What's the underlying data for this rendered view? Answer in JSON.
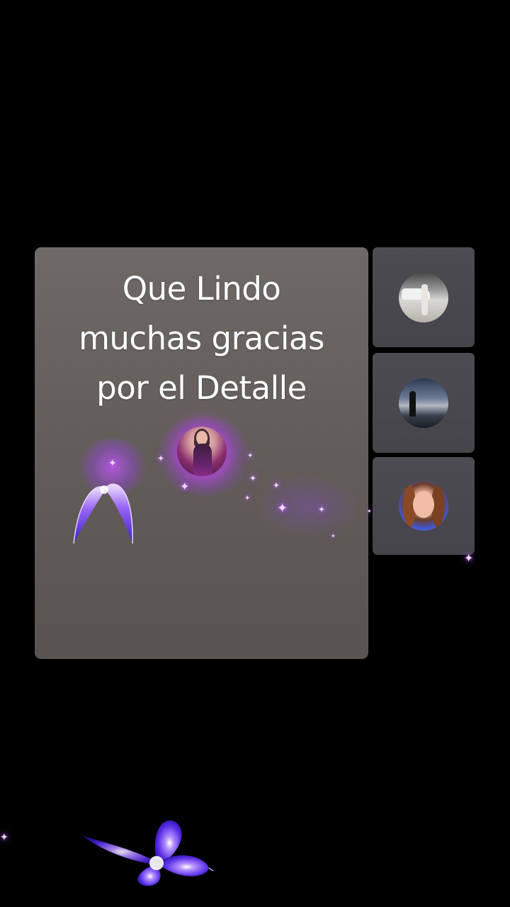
{
  "caption": {
    "line1": "Que Lindo",
    "line2": "muchas gracias",
    "line3": "por el Detalle"
  },
  "colors": {
    "background": "#000000",
    "main_tile": "#655f5c",
    "side_tile": "#48474d",
    "glow": "#b64bff",
    "butterfly": "#7a3cff"
  },
  "icons": {
    "butterfly_top": "butterfly-icon",
    "butterfly_bottom": "butterfly-icon",
    "sparkle": "sparkle-icon"
  }
}
